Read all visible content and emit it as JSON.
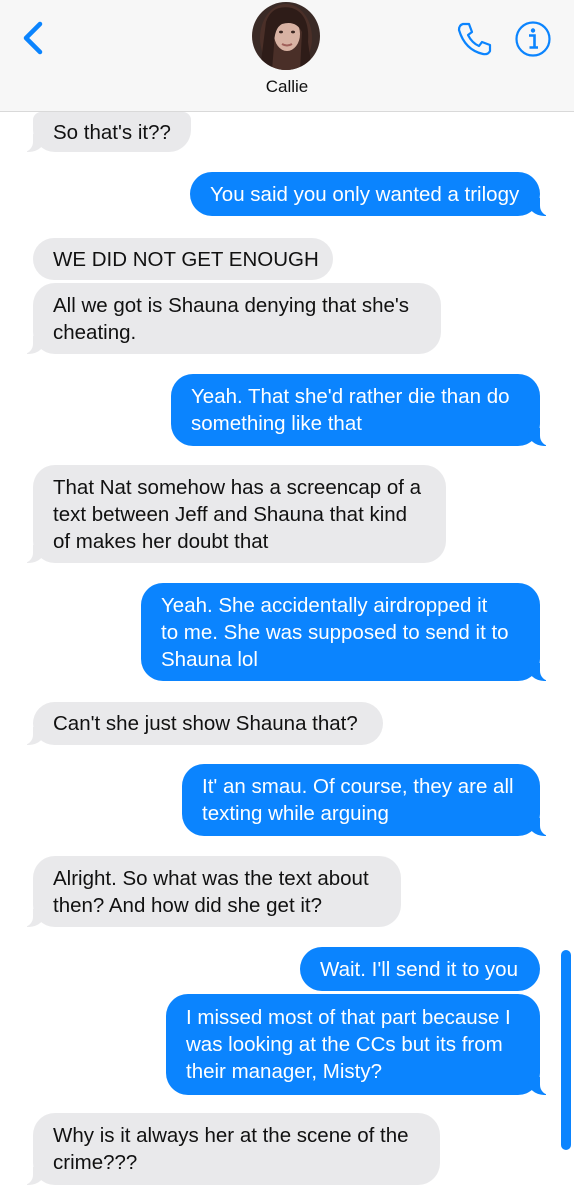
{
  "header": {
    "contact_name": "Callie",
    "colors": {
      "accent": "#0b84fe",
      "header_bg": "#f7f7f7"
    },
    "icons": {
      "back": "chevron-left-icon",
      "phone": "phone-icon",
      "info": "info-icon"
    }
  },
  "messages": [
    {
      "from": "them",
      "text": "So that's it??"
    },
    {
      "from": "me",
      "text": "You said you only wanted a trilogy"
    },
    {
      "from": "them",
      "text": "WE DID NOT GET ENOUGH"
    },
    {
      "from": "them",
      "lines": [
        "All we got is Shauna denying that she's",
        "cheating."
      ]
    },
    {
      "from": "me",
      "lines": [
        "Yeah. That she'd rather die than do",
        "something like that"
      ]
    },
    {
      "from": "them",
      "lines": [
        "That Nat somehow has a screencap of a",
        "text  between Jeff and Shauna that kind",
        "of makes her doubt that"
      ]
    },
    {
      "from": "me",
      "lines": [
        "Yeah. She accidentally airdropped it",
        "to me. She was supposed to send it to",
        "Shauna lol"
      ]
    },
    {
      "from": "them",
      "text": "Can't she just show Shauna that?"
    },
    {
      "from": "me",
      "lines": [
        "It' an smau. Of course, they are all",
        "texting while arguing"
      ]
    },
    {
      "from": "them",
      "lines": [
        "Alright. So what was the text about",
        "then? And how did she get it?"
      ]
    },
    {
      "from": "me",
      "text": "Wait. I'll send it to you"
    },
    {
      "from": "me",
      "lines": [
        "I missed most of that part because I",
        "was looking at the CCs but its from",
        "their manager, Misty?"
      ]
    },
    {
      "from": "them",
      "lines": [
        "Why is it always her at the scene of the",
        "crime???"
      ]
    }
  ],
  "colors": {
    "incoming_bubble": "#e9e9eb",
    "outgoing_bubble": "#0b84fe"
  }
}
